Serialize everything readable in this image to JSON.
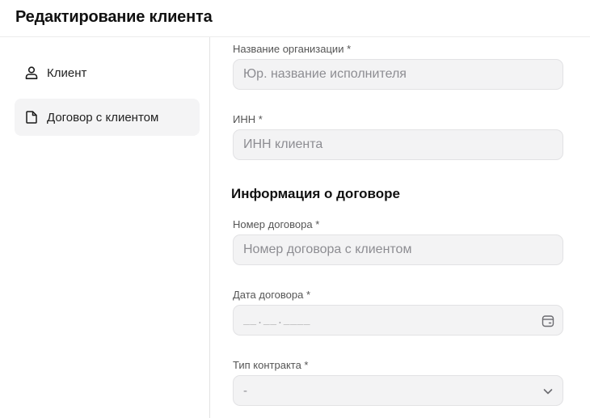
{
  "page": {
    "title": "Редактирование клиента"
  },
  "sidebar": {
    "items": [
      {
        "label": "Клиент",
        "icon": "user-icon",
        "active": false
      },
      {
        "label": "Договор с клиентом",
        "icon": "document-icon",
        "active": true
      }
    ]
  },
  "form": {
    "org_name": {
      "label": "Название организации *",
      "placeholder": "Юр. название исполнителя",
      "value": ""
    },
    "inn": {
      "label": "ИНН *",
      "placeholder": "ИНН клиента",
      "value": ""
    },
    "contract_section": {
      "title": "Информация о договоре"
    },
    "contract_number": {
      "label": "Номер договора *",
      "placeholder": "Номер договора с клиентом",
      "value": ""
    },
    "contract_date": {
      "label": "Дата договора *",
      "mask": "__.__.____",
      "icon": "calendar-icon"
    },
    "contract_type": {
      "label": "Тип контракта *",
      "selected": "-",
      "icon": "chevron-down-icon"
    }
  },
  "colors": {
    "input_bg": "#f3f3f4",
    "active_nav_bg": "#f4f4f5",
    "text": "#1a1a1a",
    "placeholder": "#8d8d92"
  }
}
